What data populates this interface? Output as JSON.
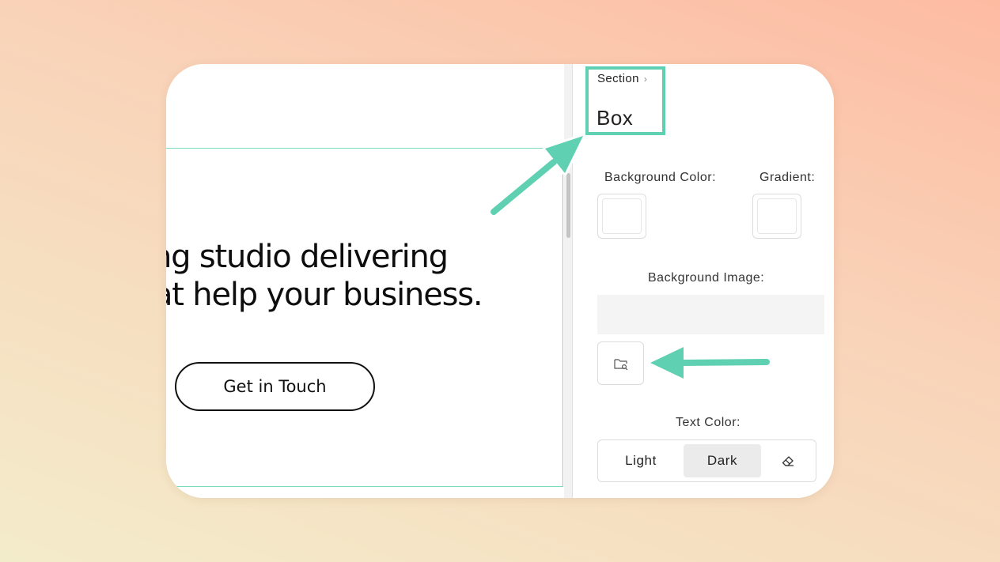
{
  "canvas": {
    "headline_line1": "ng studio delivering",
    "headline_line2": "at help your business.",
    "cta_label": "Get in Touch"
  },
  "panel": {
    "breadcrumb": "Section",
    "component_title": "Box",
    "background_color_label": "Background Color:",
    "gradient_label": "Gradient:",
    "background_image_label": "Background Image:",
    "text_color_label": "Text Color:",
    "text_color_options": [
      "Light",
      "Dark"
    ],
    "text_color_selected": "Dark"
  },
  "colors": {
    "accent": "#5fd0b1",
    "selection_outline": "#7bdcbb"
  },
  "icons": {
    "breadcrumb_chevron": "chevron-right-icon",
    "folder_search": "folder-search-icon",
    "eraser": "eraser-icon"
  }
}
